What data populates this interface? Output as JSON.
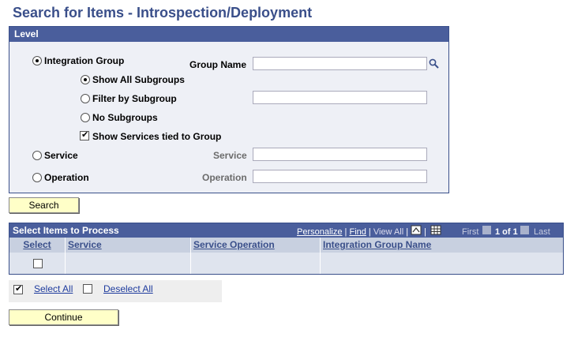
{
  "title": "Search for Items - Introspection/Deployment",
  "level": {
    "header": "Level",
    "integration_group": "Integration Group",
    "group_name_label": "Group Name",
    "show_all_subgroups": "Show All Subgroups",
    "filter_by_subgroup": "Filter by Subgroup",
    "no_subgroups": "No Subgroups",
    "show_services_tied": "Show Services tied to Group",
    "service": "Service",
    "service_label": "Service",
    "operation": "Operation",
    "operation_label": "Operation",
    "group_name_value": "",
    "subgroup_value": "",
    "service_value": "",
    "operation_value": ""
  },
  "search_button": "Search",
  "grid": {
    "title": "Select Items to Process",
    "personalize": "Personalize",
    "find": "Find",
    "view_all": "View All",
    "first": "First",
    "page": "1 of 1",
    "last": "Last",
    "columns": [
      "Select",
      "Service",
      "Service Operation",
      "Integration Group Name"
    ]
  },
  "select_all": "Select All",
  "deselect_all": "Deselect All",
  "continue_button": "Continue",
  "colors": {
    "header": "#4a5e9c",
    "title": "#3a4f8a",
    "button": "#ffffc8"
  }
}
